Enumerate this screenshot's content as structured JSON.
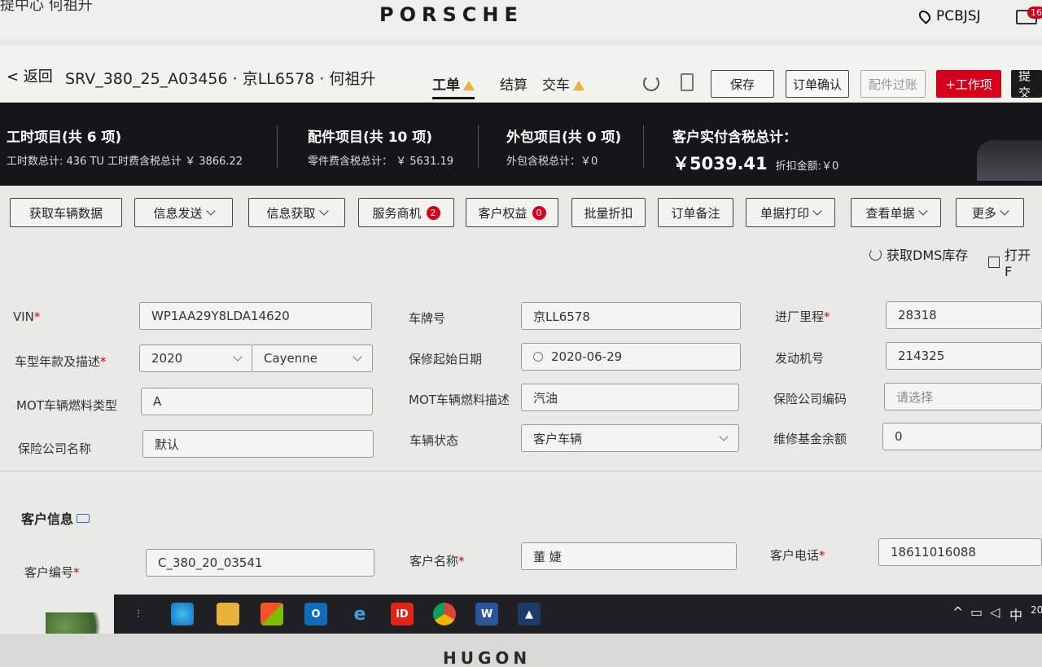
{
  "brand": {
    "crumb": "提中心  何祖升",
    "logo": "PORSCHE",
    "location": "PCBJSJ",
    "mail_badge": "16"
  },
  "header": {
    "back": "< 返回",
    "order_title": "SRV_380_25_A03456 · 京LL6578 · 何祖升",
    "tabs": [
      {
        "label": "工单",
        "warn": true
      },
      {
        "label": "结算",
        "warn": false
      },
      {
        "label": "交车",
        "warn": true
      }
    ],
    "buttons": {
      "save": "保存",
      "confirm": "订单确认",
      "parts_check": "配件过账",
      "add_job": "+工作项",
      "submit": "提交"
    }
  },
  "summary": {
    "labor": {
      "title": "工时项目(共 6 项)",
      "sub": "工时数总计: 436 TU 工时费含税总计 ￥ 3866.22"
    },
    "parts": {
      "title": "配件项目(共 10 项)",
      "sub": "零件费含税总计： ￥ 5631.19"
    },
    "outsource": {
      "title": "外包项目(共 0 项)",
      "sub": "外包含税总计：￥0"
    },
    "customer": {
      "title": "客户实付含税总计：",
      "amount": "￥5039.41",
      "discount": "折扣金额:￥0"
    }
  },
  "actions": {
    "get_vehicle": "获取车辆数据",
    "info_send": "信息发送",
    "info_get": "信息获取",
    "opportunity": "服务商机",
    "opportunity_count": "2",
    "rights": "客户权益",
    "rights_count": "0",
    "batch_discount": "批量折扣",
    "order_note": "订单备注",
    "print": "单据打印",
    "view_docs": "查看单据",
    "more": "更多",
    "dms_stock": "获取DMS库存",
    "open": "打开 F"
  },
  "vehicle": {
    "vin_label": "VIN",
    "vin": "WP1AA29Y8LDA14620",
    "plate_label": "车牌号",
    "plate": "京LL6578",
    "mileage_label": "进厂里程",
    "mileage": "28318",
    "model_label": "车型年款及描述",
    "model_year": "2020",
    "model": "Cayenne",
    "warranty_label": "保修起始日期",
    "warranty": "2020-06-29",
    "engine_label": "发动机号",
    "engine": "214325",
    "fuel_type_label": "MOT车辆燃料类型",
    "fuel_type": "A",
    "fuel_desc_label": "MOT车辆燃料描述",
    "fuel_desc": "汽油",
    "ins_code_label": "保险公司编码",
    "ins_code_placeholder": "请选择",
    "ins_name_label": "保险公司名称",
    "ins_name": "默认",
    "status_label": "车辆状态",
    "status": "客户车辆",
    "fund_label": "维修基金余额",
    "fund": "0"
  },
  "customer": {
    "section": "客户信息",
    "id_label": "客户编号",
    "id": "C_380_20_03541",
    "name_label": "客户名称",
    "name": "董 婕",
    "phone_label": "客户电话",
    "phone": "18611016088"
  },
  "taskbar": {
    "ime": "中",
    "clock": "20"
  },
  "monitor": {
    "brand": "HUGON"
  }
}
